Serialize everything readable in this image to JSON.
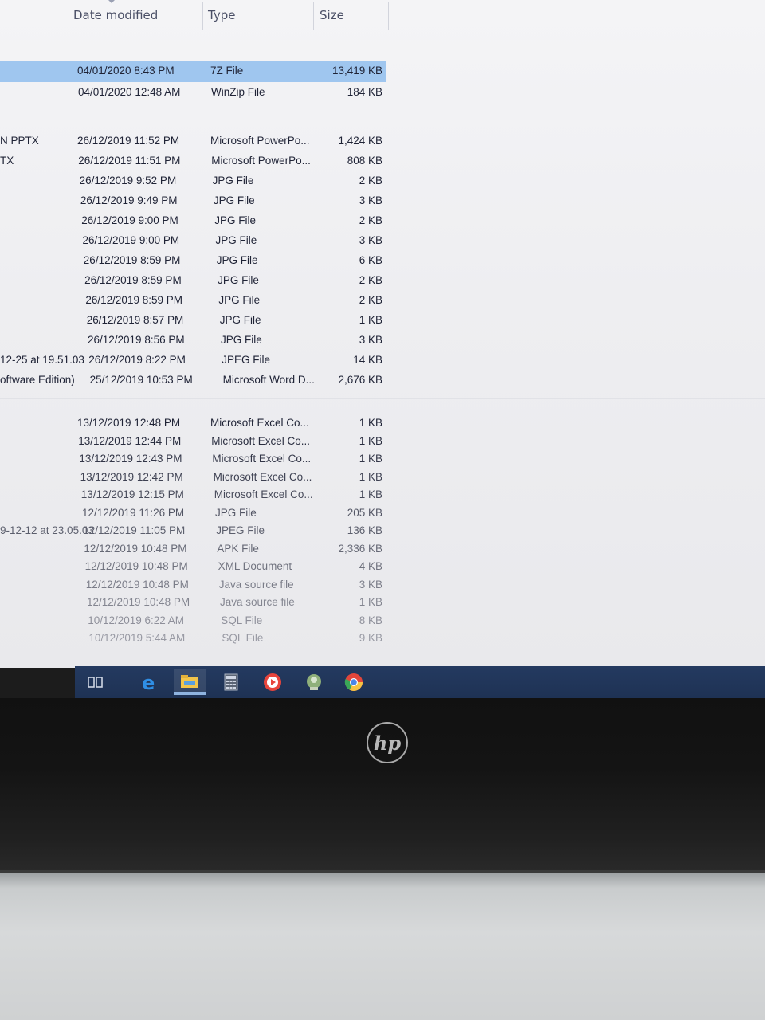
{
  "header": {
    "date_modified": "Date modified",
    "type": "Type",
    "size": "Size"
  },
  "rows_group1": [
    {
      "name": "",
      "date": "04/01/2020 8:43 PM",
      "type": "7Z File",
      "size": "13,419 KB",
      "selected": true
    },
    {
      "name": "",
      "date": "04/01/2020 12:48 AM",
      "type": "WinZip File",
      "size": "184 KB"
    }
  ],
  "rows_group2": [
    {
      "name": "N PPTX",
      "date": "26/12/2019 11:52 PM",
      "type": "Microsoft PowerPo...",
      "size": "1,424 KB"
    },
    {
      "name": "TX",
      "date": "26/12/2019 11:51 PM",
      "type": "Microsoft PowerPo...",
      "size": "808 KB"
    },
    {
      "name": "",
      "date": "26/12/2019 9:52 PM",
      "type": "JPG File",
      "size": "2 KB"
    },
    {
      "name": "",
      "date": "26/12/2019 9:49 PM",
      "type": "JPG File",
      "size": "3 KB"
    },
    {
      "name": "",
      "date": "26/12/2019 9:00 PM",
      "type": "JPG File",
      "size": "2 KB"
    },
    {
      "name": "",
      "date": "26/12/2019 9:00 PM",
      "type": "JPG File",
      "size": "3 KB"
    },
    {
      "name": "",
      "date": "26/12/2019 8:59 PM",
      "type": "JPG File",
      "size": "6 KB"
    },
    {
      "name": "",
      "date": "26/12/2019 8:59 PM",
      "type": "JPG File",
      "size": "2 KB"
    },
    {
      "name": "",
      "date": "26/12/2019 8:59 PM",
      "type": "JPG File",
      "size": "2 KB"
    },
    {
      "name": "",
      "date": "26/12/2019 8:57 PM",
      "type": "JPG File",
      "size": "1 KB"
    },
    {
      "name": "",
      "date": "26/12/2019 8:56 PM",
      "type": "JPG File",
      "size": "3 KB"
    },
    {
      "name": "12-25 at 19.51.03",
      "date": "26/12/2019 8:22 PM",
      "type": "JPEG File",
      "size": "14 KB"
    },
    {
      "name": "oftware Edition)",
      "date": "25/12/2019 10:53 PM",
      "type": "Microsoft Word D...",
      "size": "2,676 KB"
    }
  ],
  "rows_group3": [
    {
      "name": "",
      "date": "13/12/2019 12:48 PM",
      "type": "Microsoft Excel Co...",
      "size": "1 KB"
    },
    {
      "name": "",
      "date": "13/12/2019 12:44 PM",
      "type": "Microsoft Excel Co...",
      "size": "1 KB"
    },
    {
      "name": "",
      "date": "13/12/2019 12:43 PM",
      "type": "Microsoft Excel Co...",
      "size": "1 KB"
    },
    {
      "name": "",
      "date": "13/12/2019 12:42 PM",
      "type": "Microsoft Excel Co...",
      "size": "1 KB"
    },
    {
      "name": "",
      "date": "13/12/2019 12:15 PM",
      "type": "Microsoft Excel Co...",
      "size": "1 KB"
    },
    {
      "name": "",
      "date": "12/12/2019 11:26 PM",
      "type": "JPG File",
      "size": "205 KB"
    },
    {
      "name": "9-12-12 at 23.05.03",
      "date": "12/12/2019 11:05 PM",
      "type": "JPEG File",
      "size": "136 KB"
    },
    {
      "name": "",
      "date": "12/12/2019 10:48 PM",
      "type": "APK File",
      "size": "2,336 KB"
    },
    {
      "name": "",
      "date": "12/12/2019 10:48 PM",
      "type": "XML Document",
      "size": "4 KB"
    },
    {
      "name": "",
      "date": "12/12/2019 10:48 PM",
      "type": "Java source file",
      "size": "3 KB"
    },
    {
      "name": "",
      "date": "12/12/2019 10:48 PM",
      "type": "Java source file",
      "size": "1 KB"
    },
    {
      "name": "",
      "date": "10/12/2019 6:22 AM",
      "type": "SQL File",
      "size": "8 KB"
    },
    {
      "name": "",
      "date": "10/12/2019 5:44 AM",
      "type": "SQL File",
      "size": "9 KB"
    }
  ],
  "taskbar": {
    "icons": [
      "task-view-icon",
      "edge-icon",
      "file-explorer-icon",
      "calculator-icon",
      "media-player-icon",
      "chat-icon",
      "chrome-icon"
    ],
    "accent": "#1e3254"
  },
  "bezel": {
    "logo": "hp"
  },
  "colors": {
    "selection": "#9fc6ef",
    "text": "#1f2336"
  }
}
